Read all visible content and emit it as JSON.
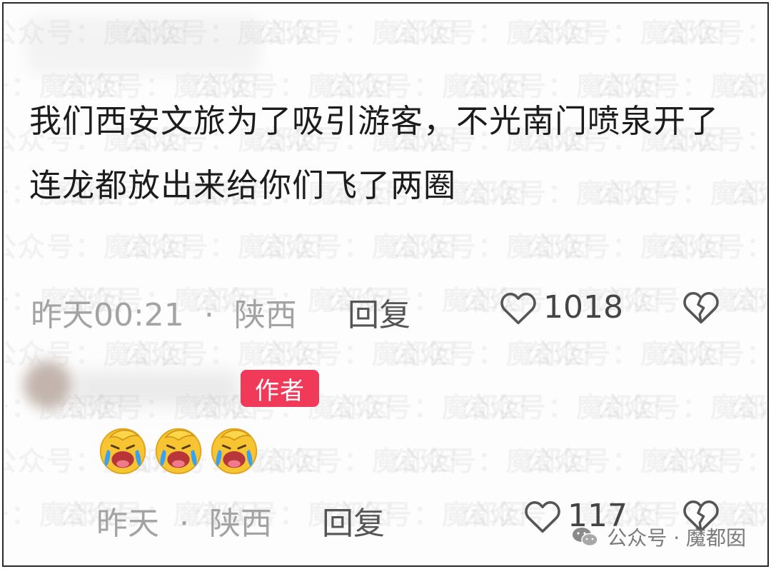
{
  "watermark": {
    "text": "公众号：魔都囡"
  },
  "comment1": {
    "text": "我们西安文旅为了吸引游客，不光南门喷泉开了  连龙都放出来给你们飞了两圈",
    "time": "昨天00:21",
    "location": "陕西",
    "separator": "·",
    "reply_label": "回复",
    "likes": "1018",
    "like_icon": "heart-outline-icon",
    "dislike_icon": "broken-heart-icon"
  },
  "comment2": {
    "author_badge": "作者",
    "emojis": [
      "laugh-cry-emoji",
      "laugh-cry-emoji",
      "laugh-cry-emoji"
    ],
    "time": "昨天",
    "location": "陕西",
    "separator": "·",
    "reply_label": "回复",
    "likes": "117",
    "like_icon": "heart-outline-icon",
    "dislike_icon": "broken-heart-icon"
  },
  "footer": {
    "label": "公众号 · 魔都囡",
    "icon": "wechat-icon"
  }
}
